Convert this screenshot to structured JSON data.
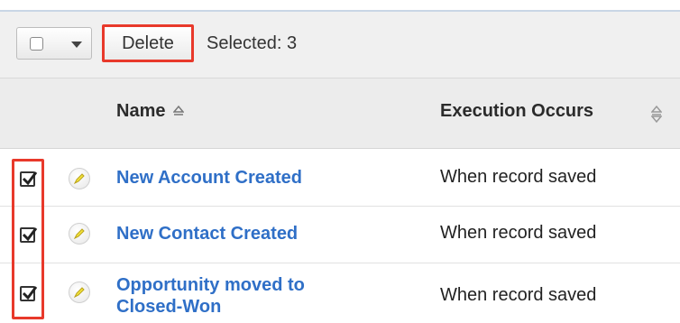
{
  "toolbar": {
    "delete_label": "Delete",
    "selected_text": "Selected: 3"
  },
  "columns": {
    "name": "Name",
    "execution": "Execution Occurs"
  },
  "rows": [
    {
      "name": "New Account Created",
      "execution": "When record saved",
      "checked": true
    },
    {
      "name": "New Contact Created",
      "execution": "When record saved",
      "checked": true
    },
    {
      "name_line1": "Opportunity moved to",
      "name_line2": "Closed-Won",
      "execution": "When record saved",
      "checked": true
    }
  ],
  "colors": {
    "highlight": "#e8392b",
    "link": "#2f6fc7"
  }
}
